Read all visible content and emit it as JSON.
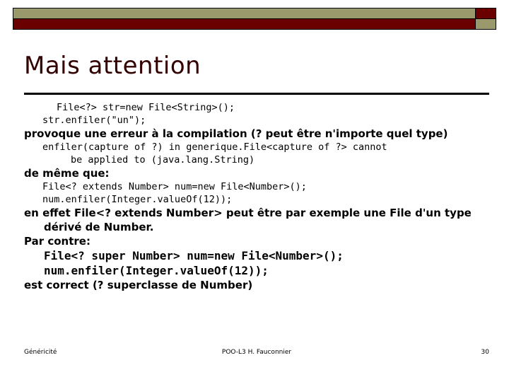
{
  "slide": {
    "title": "Mais attention",
    "colors": {
      "title_text": "#330000",
      "bar_khaki": "#99996b",
      "bar_darkred": "#6b0000",
      "rule": "#000000",
      "body_text": "#000000"
    },
    "body": [
      {
        "kind": "code",
        "indent": "ind1",
        "text": "File<?> str=new File<String>();"
      },
      {
        "kind": "code",
        "indent": "ind2",
        "text": "str.enfiler(\"un\");"
      },
      {
        "kind": "prose",
        "indent": "none",
        "text": "provoque une erreur à la compilation (? peut être n'importe quel type)"
      },
      {
        "kind": "code",
        "indent": "ind2",
        "text": "enfiler(capture of ?) in generique.File<capture of ?> cannot"
      },
      {
        "kind": "code",
        "indent": "ind3",
        "text": "be applied to (java.lang.String)"
      },
      {
        "kind": "prose",
        "indent": "none",
        "text": "de même que:"
      },
      {
        "kind": "code",
        "indent": "ind2",
        "text": "File<? extends Number> num=new File<Number>();"
      },
      {
        "kind": "code",
        "indent": "ind2",
        "text": "num.enfiler(Integer.valueOf(12));"
      },
      {
        "kind": "prose",
        "indent": "none",
        "text": "en effet File<? extends Number> peut être par exemple une File d'un type"
      },
      {
        "kind": "prose",
        "indent": "indent",
        "text": "dérivé de Number."
      },
      {
        "kind": "prose",
        "indent": "none",
        "text": "Par contre:"
      },
      {
        "kind": "code-big",
        "indent": "none",
        "text": "File<? super Number> num=new File<Number>();"
      },
      {
        "kind": "code-big",
        "indent": "none",
        "text": "num.enfiler(Integer.valueOf(12));"
      },
      {
        "kind": "prose",
        "indent": "none",
        "text": "est correct (? superclasse de Number)"
      }
    ]
  },
  "footer": {
    "left": "Généricité",
    "center": "POO-L3 H. Fauconnier",
    "page_number": "30"
  }
}
